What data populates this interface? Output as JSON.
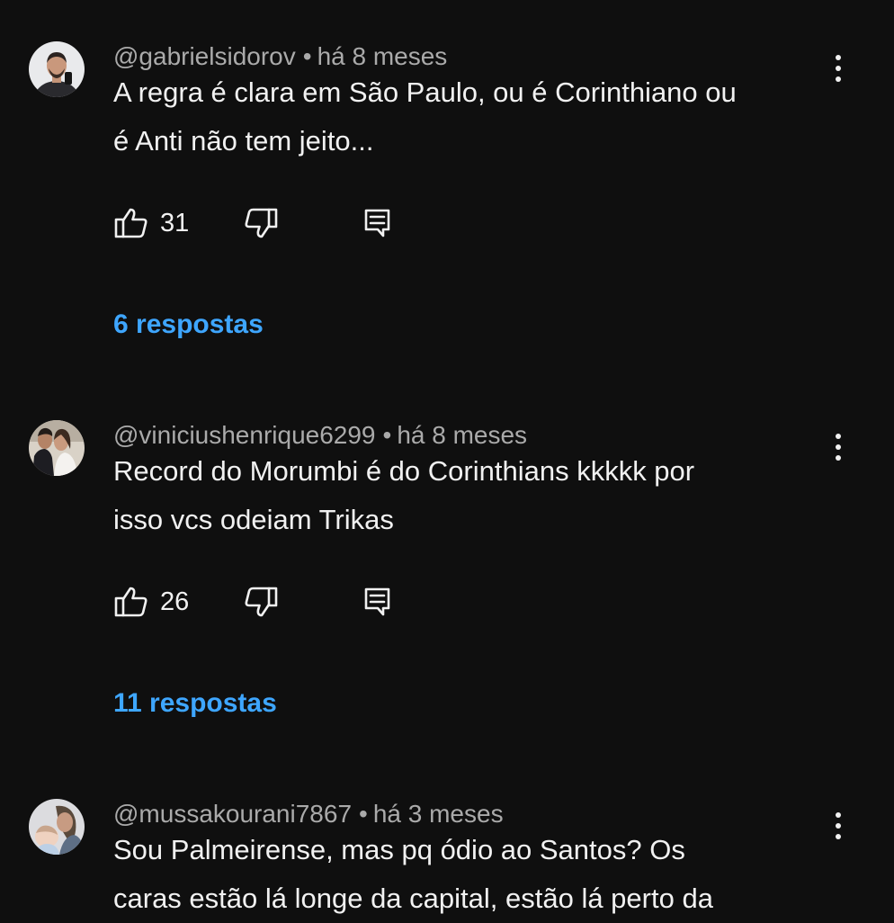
{
  "comments": [
    {
      "author": "@gabrielsidorov",
      "time": "há 8 meses",
      "text_lines": [
        "A regra é clara em São Paulo, ou é Corinthiano ou",
        "é Anti não tem jeito..."
      ],
      "likes": "31",
      "replies": "6 respostas"
    },
    {
      "author": "@viniciushenrique6299",
      "time": "há 8 meses",
      "text_lines": [
        "Record do Morumbi é do Corinthians kkkkk por",
        "isso vcs odeiam Trikas"
      ],
      "likes": "26",
      "replies": "11 respostas"
    },
    {
      "author": "@mussakourani7867",
      "time": "há 3 meses",
      "text_lines": [
        "Sou Palmeirense, mas pq ódio ao Santos? Os",
        "caras estão lá longe da capital, estão lá perto da"
      ]
    }
  ],
  "separator": "•",
  "icons": {
    "like": "thumb-up-icon",
    "dislike": "thumb-down-icon",
    "reply": "reply-icon",
    "menu": "more-vert-icon"
  },
  "colors": {
    "background": "#0f0f0f",
    "text": "#f1f1f1",
    "meta": "#aaaaaa",
    "link": "#3ea6ff"
  }
}
